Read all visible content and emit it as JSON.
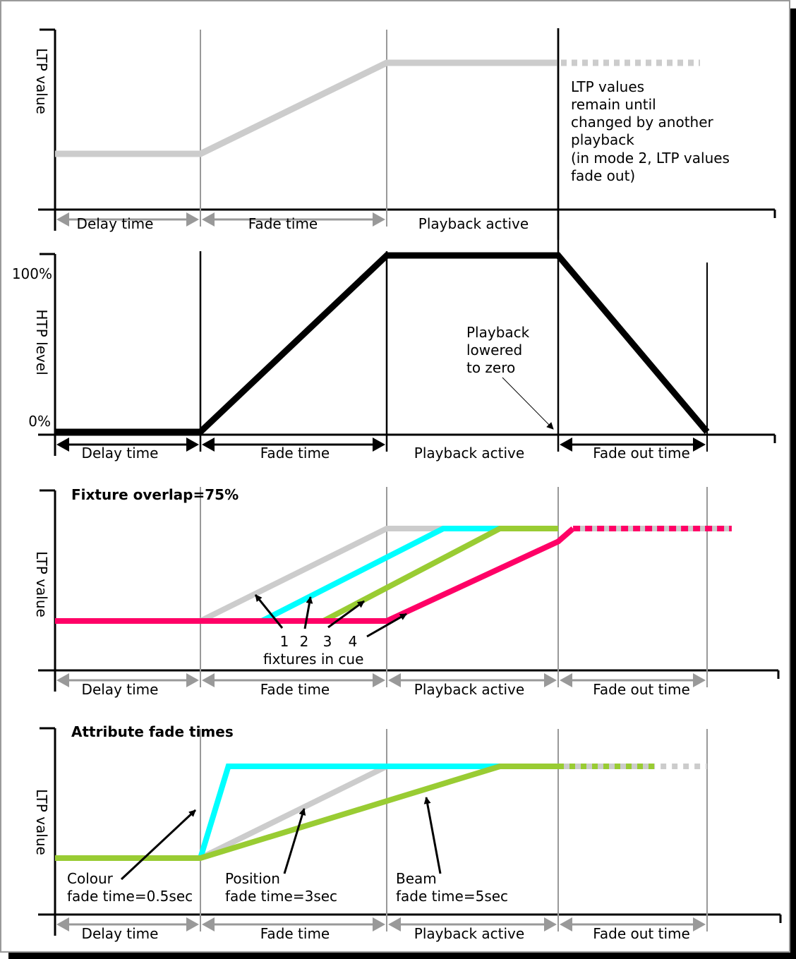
{
  "colors": {
    "grey_line": "#cccccc",
    "guide_grey": "#999999",
    "black": "#000000",
    "cyan": "#00ffff",
    "green": "#99cc33",
    "magenta": "#ff0066"
  },
  "phases": {
    "delay": "Delay time",
    "fade": "Fade time",
    "active": "Playback active",
    "fade_out": "Fade out time"
  },
  "panel1": {
    "ylabel": "LTP value",
    "note": [
      "LTP values",
      "remain until",
      "changed by another",
      "playback",
      "(in mode 2, LTP values",
      "fade out)"
    ],
    "series": [
      {
        "name": "LTP value",
        "color": "grey_line",
        "points": [
          [
            0,
            0.25
          ],
          [
            1,
            0.25
          ],
          [
            2,
            0.75
          ],
          [
            3,
            0.75
          ]
        ],
        "dashed_to": 4.0
      }
    ]
  },
  "panel2": {
    "ylabel": "HTP level",
    "tick_top": "100%",
    "tick_bottom": "0%",
    "note": [
      "Playback",
      "lowered",
      "to zero"
    ],
    "series": [
      {
        "name": "HTP level",
        "color": "black",
        "points": [
          [
            0,
            0
          ],
          [
            1,
            0
          ],
          [
            2,
            1
          ],
          [
            3,
            1
          ],
          [
            4,
            0
          ]
        ]
      }
    ]
  },
  "panel3": {
    "title": "Fixture overlap=75%",
    "ylabel": "LTP value",
    "fixture_numbers": [
      "1",
      "2",
      "3",
      "4"
    ],
    "fixtures_caption": "fixtures in cue",
    "series": [
      {
        "name": "Fixture 1",
        "color": "grey_line",
        "points": [
          [
            1,
            0.25
          ],
          [
            2,
            0.75
          ],
          [
            3,
            0.75
          ]
        ]
      },
      {
        "name": "Fixture 2",
        "color": "cyan",
        "points": [
          [
            1.33,
            0.25
          ],
          [
            2.33,
            0.75
          ],
          [
            3,
            0.75
          ]
        ]
      },
      {
        "name": "Fixture 3",
        "color": "green",
        "points": [
          [
            1.66,
            0.25
          ],
          [
            2.66,
            0.75
          ],
          [
            3,
            0.75
          ]
        ]
      },
      {
        "name": "Fixture 4",
        "color": "magenta",
        "points": [
          [
            0,
            0.25
          ],
          [
            2,
            0.25
          ],
          [
            3.0,
            0.68
          ],
          [
            3.1,
            0.75
          ]
        ],
        "dashed_to": 4.08
      }
    ]
  },
  "panel4": {
    "title": "Attribute fade times",
    "ylabel": "LTP value",
    "labels": {
      "colour": [
        "Colour",
        "fade time=0.5sec"
      ],
      "position": [
        "Position",
        "fade time=3sec"
      ],
      "beam": [
        "Beam",
        "fade time=5sec"
      ]
    },
    "series": [
      {
        "name": "Position",
        "color": "grey_line",
        "points": [
          [
            1,
            0.25
          ],
          [
            2,
            0.75
          ]
        ]
      },
      {
        "name": "Colour",
        "color": "cyan",
        "points": [
          [
            1,
            0.25
          ],
          [
            1.15,
            0.75
          ],
          [
            2.66,
            0.75
          ]
        ]
      },
      {
        "name": "Beam",
        "color": "green",
        "points": [
          [
            0,
            0.25
          ],
          [
            1,
            0.25
          ],
          [
            2.66,
            0.75
          ],
          [
            3,
            0.75
          ]
        ],
        "dashed_to": 4.0
      }
    ]
  }
}
